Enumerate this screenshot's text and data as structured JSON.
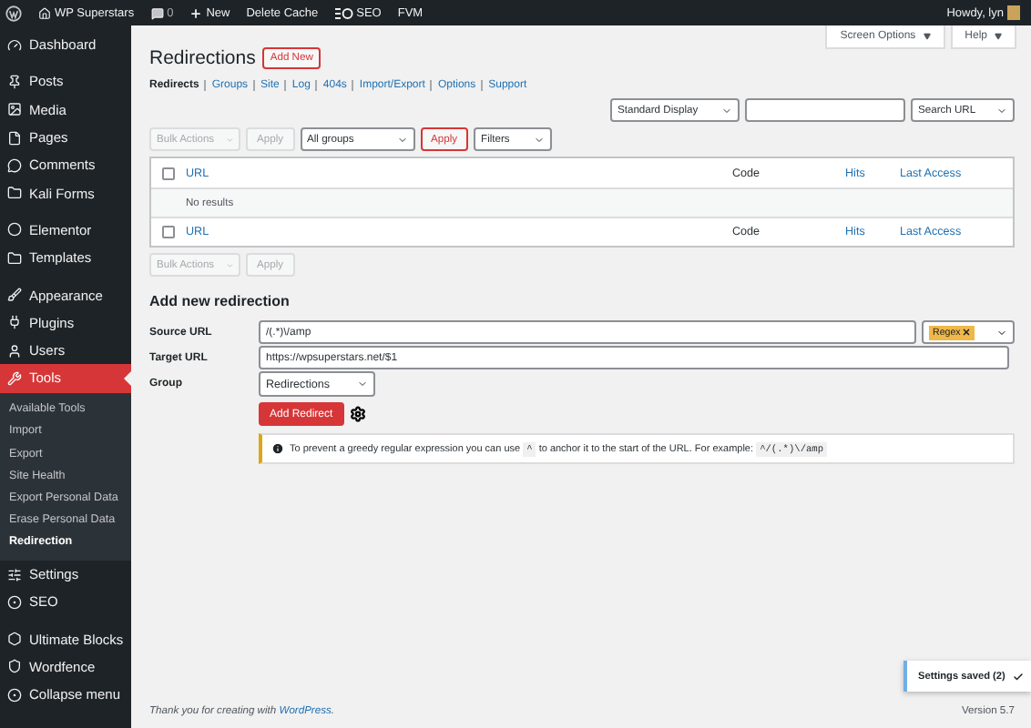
{
  "admin_bar": {
    "site": "WP Superstars",
    "comments": "0",
    "items": [
      {
        "kind": "new",
        "label": "New"
      },
      {
        "kind": "plain",
        "label": "Delete Cache"
      },
      {
        "kind": "seo",
        "label": "SEO"
      },
      {
        "kind": "plain",
        "label": "FVM"
      }
    ],
    "greeting": "Howdy, lyn"
  },
  "sidebar": {
    "groups": [
      {
        "items": [
          {
            "label": "Dashboard",
            "selected": false
          }
        ]
      },
      {
        "items": [
          {
            "label": "Posts",
            "selected": false
          },
          {
            "label": "Media",
            "selected": false
          },
          {
            "label": "Pages",
            "selected": false
          },
          {
            "label": "Comments",
            "selected": false
          },
          {
            "label": "Kali Forms",
            "selected": false
          }
        ]
      },
      {
        "items": [
          {
            "label": "Elementor",
            "selected": false
          },
          {
            "label": "Templates",
            "selected": false
          }
        ]
      },
      {
        "items": [
          {
            "label": "Appearance",
            "selected": false
          },
          {
            "label": "Plugins",
            "selected": false
          },
          {
            "label": "Users",
            "selected": false
          },
          {
            "label": "Tools",
            "selected": true,
            "children": [
              {
                "label": "Available Tools",
                "selected": false
              },
              {
                "label": "Import",
                "selected": false
              },
              {
                "label": "Export",
                "selected": false
              },
              {
                "label": "Site Health",
                "selected": false
              },
              {
                "label": "Export Personal Data",
                "selected": false
              },
              {
                "label": "Erase Personal Data",
                "selected": false
              },
              {
                "label": "Redirection",
                "selected": true
              }
            ]
          },
          {
            "label": "Settings",
            "selected": false
          },
          {
            "label": "SEO",
            "selected": false
          }
        ]
      },
      {
        "items": [
          {
            "label": "Ultimate Blocks",
            "selected": false
          },
          {
            "label": "Wordfence",
            "selected": false
          },
          {
            "label": "Collapse menu",
            "selected": false
          }
        ]
      }
    ]
  },
  "screen_tabs": [
    "Screen Options",
    "Help"
  ],
  "title": "Redirections",
  "add_new": "Add New",
  "subnav": [
    {
      "label": "Redirects",
      "selected": true
    },
    {
      "label": "Groups",
      "selected": false
    },
    {
      "label": "Site",
      "selected": false
    },
    {
      "label": "Log",
      "selected": false
    },
    {
      "label": "404s",
      "selected": false
    },
    {
      "label": "Import/Export",
      "selected": false
    },
    {
      "label": "Options",
      "selected": false
    },
    {
      "label": "Support",
      "selected": false
    }
  ],
  "display_select": "Standard Display",
  "search_select": "Search URL",
  "top_actions": [
    {
      "kind": "select",
      "label": "Bulk Actions",
      "disabled": true
    },
    {
      "kind": "button",
      "label": "Apply",
      "disabled": true
    },
    {
      "kind": "wide-select",
      "label": "All groups",
      "disabled": false
    },
    {
      "kind": "accent",
      "label": "Apply",
      "disabled": false
    },
    {
      "kind": "select",
      "label": "Filters",
      "disabled": false
    }
  ],
  "table": {
    "header_checked": false,
    "footer_checked": false,
    "columns": [
      {
        "label": "URL",
        "sortable": true
      },
      {
        "label": "Code",
        "sortable": false
      },
      {
        "label": "Hits",
        "sortable": true
      },
      {
        "label": "Last Access",
        "sortable": true
      }
    ],
    "footer_columns": [
      {
        "label": "URL",
        "sortable": true
      },
      {
        "label": "Code",
        "sortable": false
      },
      {
        "label": "Hits",
        "sortable": true
      },
      {
        "label": "Last Access",
        "sortable": true
      }
    ],
    "empty": "No results"
  },
  "bottom_actions": [
    {
      "kind": "select",
      "label": "Bulk Actions",
      "disabled": true
    },
    {
      "kind": "button",
      "label": "Apply",
      "disabled": true
    }
  ],
  "form": {
    "heading": "Add new redirection",
    "source_label": "Source URL",
    "source": "/(.*)\\/amp",
    "regex": {
      "label": "Regex",
      "on": true
    },
    "target_label": "Target URL",
    "target": "https://wpsuperstars.net/$1",
    "group_label": "Group",
    "group": "Redirections",
    "submit": "Add Redirect",
    "notice": [
      {
        "kind": "text",
        "text": "To prevent a greedy regular expression you can use "
      },
      {
        "kind": "code",
        "text": "^"
      },
      {
        "kind": "text",
        "text": " to anchor it to the start of the URL. For example: "
      },
      {
        "kind": "code",
        "text": "^/(.*)\\/amp"
      }
    ]
  },
  "footer": {
    "before": "Thank you for creating with ",
    "link": "WordPress",
    "after": ".",
    "version": "Version 5.7"
  },
  "toast": "Settings saved (2)"
}
